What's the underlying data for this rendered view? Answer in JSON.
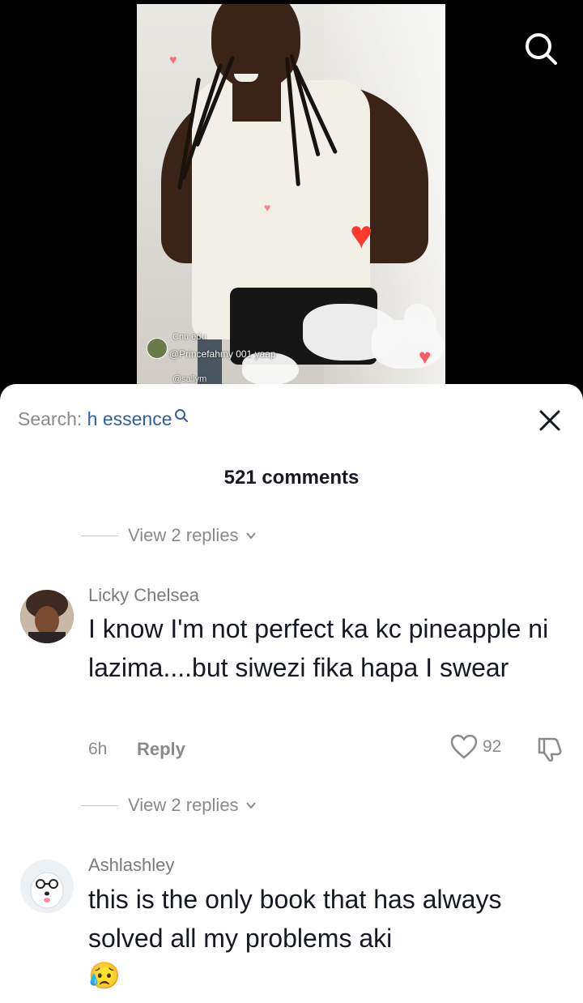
{
  "video": {
    "overlay_user_top": "Cnu edu",
    "overlay_handle_line": "@Princefahmy 001 yaap",
    "overlay_user_bottom": "@sallym"
  },
  "sheet": {
    "search_prefix": "Search: ",
    "search_query": "h essence",
    "comment_count": "521 comments"
  },
  "threads": [
    {
      "view_replies": "View 2 replies"
    },
    {
      "view_replies": "View 2 replies"
    }
  ],
  "comments": [
    {
      "username": "Licky Chelsea",
      "text": "I know I'm not perfect ka kc pineapple ni lazima....but siwezi fika hapa I swear",
      "time": "6h",
      "reply_label": "Reply",
      "likes": "92"
    },
    {
      "username": "Ashlashley",
      "text": "this is the only book that has always solved all my problems aki",
      "emoji": "😥"
    }
  ],
  "icons": {
    "search": "search-icon",
    "close": "close-icon",
    "like": "heart-outline-icon",
    "dislike": "thumbs-down-icon",
    "chevron": "chevron-down-icon"
  },
  "colors": {
    "query_link": "#2f5f9e",
    "muted_text": "#8a8a8a",
    "primary_text": "#161823",
    "heart": "#ff3b30"
  }
}
